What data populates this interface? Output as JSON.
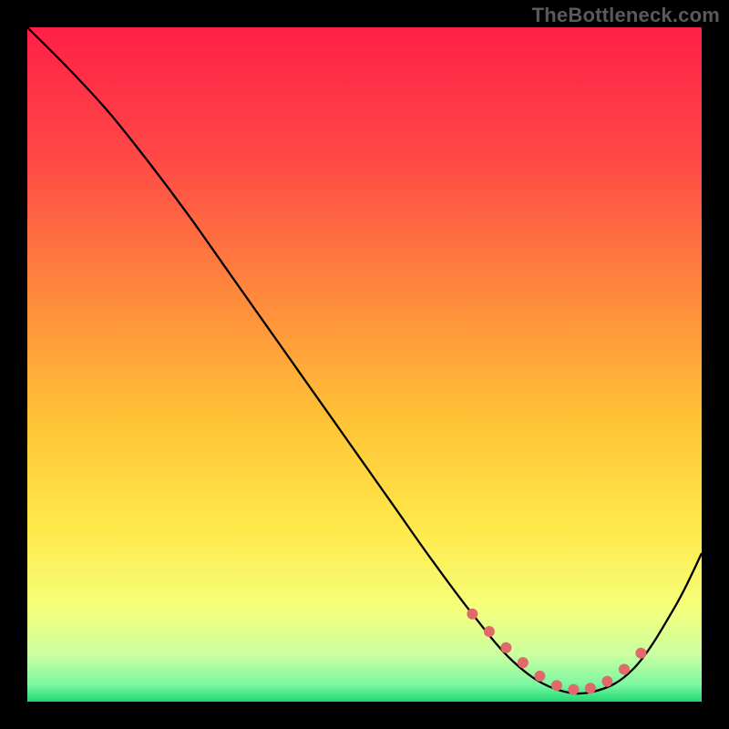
{
  "watermark": "TheBottleneck.com",
  "chart_data": {
    "type": "line",
    "title": "",
    "xlabel": "",
    "ylabel": "",
    "xlim": [
      0,
      100
    ],
    "ylim": [
      0,
      100
    ],
    "background_gradient": {
      "stops": [
        {
          "pos": 0.0,
          "color": "#ff1f47"
        },
        {
          "pos": 0.2,
          "color": "#ff4a46"
        },
        {
          "pos": 0.4,
          "color": "#ff8a3c"
        },
        {
          "pos": 0.58,
          "color": "#ffc236"
        },
        {
          "pos": 0.74,
          "color": "#ffe84a"
        },
        {
          "pos": 0.86,
          "color": "#f6ff7a"
        },
        {
          "pos": 0.93,
          "color": "#caffa0"
        },
        {
          "pos": 0.975,
          "color": "#7cf7a3"
        },
        {
          "pos": 1.0,
          "color": "#1fd86f"
        }
      ]
    },
    "series": [
      {
        "name": "bottleneck-curve",
        "color": "#000000",
        "x": [
          0,
          6,
          12,
          18,
          24,
          30,
          36,
          42,
          48,
          54,
          60,
          66,
          72,
          78,
          84,
          90,
          96,
          100
        ],
        "y": [
          100,
          94,
          87.5,
          80,
          72,
          63.5,
          55,
          46.5,
          38,
          29.5,
          21,
          13,
          6,
          2,
          1.5,
          5,
          14,
          22
        ]
      }
    ],
    "markers": {
      "name": "optimal-range",
      "color": "#e06a6a",
      "size": 6,
      "x": [
        66,
        68.5,
        71,
        73.5,
        76,
        78.5,
        81,
        83.5,
        86,
        88.5,
        91
      ],
      "y": [
        13,
        10.4,
        8,
        5.8,
        3.8,
        2.4,
        1.8,
        2.0,
        3.0,
        4.8,
        7.2
      ]
    }
  }
}
